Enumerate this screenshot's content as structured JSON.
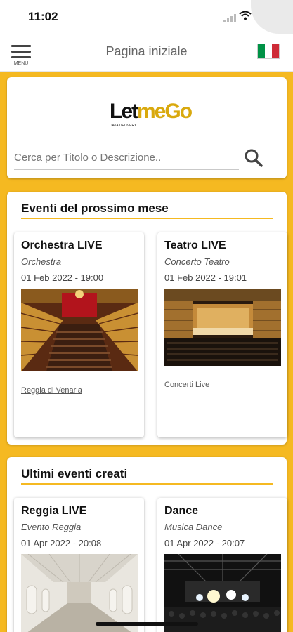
{
  "status_bar": {
    "time": "11:02"
  },
  "header": {
    "menu_label": "MENU",
    "title": "Pagina iniziale",
    "flag_colors": [
      "#009246",
      "#ffffff",
      "#ce2b37"
    ]
  },
  "search": {
    "logo_main": "Let",
    "logo_accent": "meGo",
    "logo_sub": "DATA DELIVERY",
    "placeholder": "Cerca per Titolo o Descrizione.."
  },
  "sections": [
    {
      "title": "Eventi del prossimo mese",
      "events": [
        {
          "title": "Orchestra LIVE",
          "category": "Orchestra",
          "date": "01 Feb 2022 - 19:00",
          "location": "Reggia di Venaria",
          "image": "opera-theatre-red-boxes"
        },
        {
          "title": "Teatro LIVE",
          "category": "Concerto Teatro",
          "date": "01 Feb 2022 - 19:01",
          "location": "Concerti Live",
          "image": "concert-hall-stage"
        }
      ]
    },
    {
      "title": "Ultimi eventi creati",
      "events": [
        {
          "title": "Reggia LIVE",
          "category": "Evento Reggia",
          "date": "01 Apr 2022 - 20:08",
          "image": "white-baroque-gallery"
        },
        {
          "title": "Dance",
          "category": "Musica Dance",
          "date": "01 Apr 2022 - 20:07",
          "image": "stage-lights-crowd"
        }
      ]
    }
  ],
  "colors": {
    "accent": "#f5b921",
    "text": "#111111",
    "muted": "#666666"
  }
}
